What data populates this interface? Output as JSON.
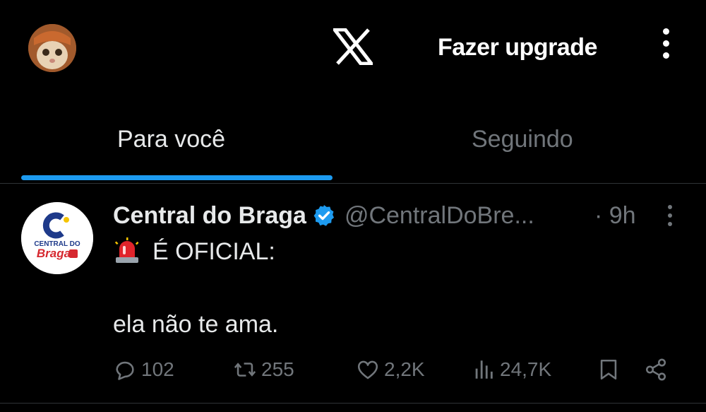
{
  "header": {
    "upgrade_label": "Fazer upgrade"
  },
  "tabs": [
    {
      "label": "Para você",
      "active": true
    },
    {
      "label": "Seguindo",
      "active": false
    }
  ],
  "tweet": {
    "author_name": "Central do Braga",
    "handle": "@CentralDoBre...",
    "time": "· 9h",
    "avatar_text_top": "CENTRAL DO",
    "avatar_text_bottom": "Braga",
    "line1": "É OFICIAL:",
    "line2": "ela não te ama.",
    "replies": "102",
    "retweets": "255",
    "likes": "2,2K",
    "views": "24,7K"
  },
  "colors": {
    "accent": "#1d9bf0",
    "background": "#000000",
    "muted": "#71767b",
    "text": "#e7e9ea"
  }
}
